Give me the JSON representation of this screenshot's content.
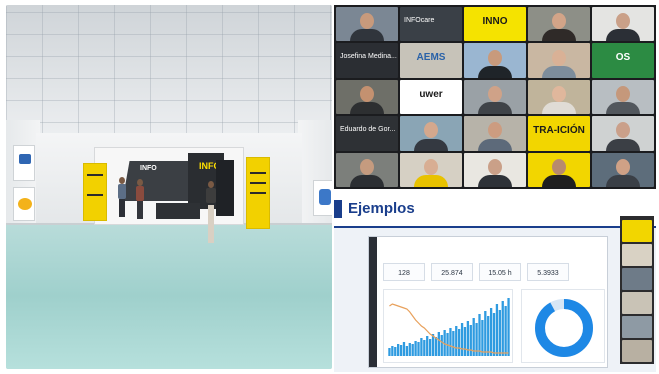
{
  "venue": {
    "stand_brand": "INFO",
    "stand_brand_secondary": "INFO",
    "caption": "",
    "footer_logos": [
      "",
      ""
    ]
  },
  "videoconference": {
    "tiles": [
      {
        "name": "",
        "bg": "#7b8794",
        "skin": "#c89a7c",
        "shirt": "#30353c"
      },
      {
        "name": "",
        "bg": "#3a4047",
        "label": "INFOcare"
      },
      {
        "name": "",
        "bg": "#f5e300",
        "logo": "INNO",
        "logo_color": "#1b1b1b"
      },
      {
        "name": "",
        "bg": "#8d8f87",
        "skin": "#d2a488",
        "shirt": "#2f2a28"
      },
      {
        "name": "",
        "bg": "#e4e4e2",
        "skin": "#caa088",
        "shirt": "#2b2f36"
      },
      {
        "name": "",
        "bg": "#2b2e33",
        "label": "Josefina Medina..."
      },
      {
        "name": "",
        "bg": "#c7c3b9",
        "logo": "AEMS",
        "logo_color": "#2a62a8"
      },
      {
        "name": "",
        "bg": "#9ab6d1",
        "skin": "#c89a7c",
        "shirt": "#1f2429"
      },
      {
        "name": "",
        "bg": "#c9b7a2",
        "skin": "#d9b196",
        "shirt": "#7d8d9c"
      },
      {
        "name": "",
        "bg": "#2c8b43",
        "logo": "OS",
        "logo_color": "#ffffff"
      },
      {
        "name": "",
        "bg": "#6e6f68",
        "skin": "#c49170",
        "shirt": "#2d2f31"
      },
      {
        "name": "",
        "bg": "#ffffff",
        "logo": "uwer",
        "logo_color": "#1b1b1b"
      },
      {
        "name": "",
        "bg": "#9aa1a6",
        "skin": "#cfa288",
        "shirt": "#3f4348"
      },
      {
        "name": "",
        "bg": "#c0b49b",
        "skin": "#e0b79c",
        "shirt": "#e0dcd5"
      },
      {
        "name": "",
        "bg": "#b8bec2",
        "skin": "#c5987b",
        "shirt": "#52575d"
      },
      {
        "name": "",
        "bg": "#2e3135",
        "label": "Eduardo de Gor..."
      },
      {
        "name": "",
        "bg": "#8aa5b5",
        "skin": "#d4a88d",
        "shirt": "#343941"
      },
      {
        "name": "",
        "bg": "#b7b3a9",
        "skin": "#cc9c80",
        "shirt": "#5d6a7a"
      },
      {
        "name": "",
        "bg": "#f2d600",
        "logo": "TRA-ICIÓN",
        "logo_color": "#1b1b1b"
      },
      {
        "name": "",
        "bg": "#cfd2d2",
        "skin": "#caa08a",
        "shirt": "#3b3f45"
      },
      {
        "name": "",
        "bg": "#7c7f7b",
        "skin": "#c59b7f",
        "shirt": "#2c2f33"
      },
      {
        "name": "",
        "bg": "#d6d0c4",
        "skin": "#d8ae93",
        "shirt": "#e8c200"
      },
      {
        "name": "",
        "bg": "#e9e7e1",
        "skin": "#caa088",
        "shirt": "#2e3238"
      },
      {
        "name": "",
        "bg": "#f2d600",
        "skin": "#b88a6e",
        "shirt": "#1f1f1f"
      },
      {
        "name": "",
        "bg": "#5d6d7b",
        "skin": "#cfa186",
        "shirt": "#3a3f46"
      }
    ]
  },
  "slide": {
    "title": "Ejemplos",
    "dashboard_title": "",
    "kpis": [
      {
        "label": "",
        "value": "128"
      },
      {
        "label": "",
        "value": "25.874"
      },
      {
        "label": "",
        "value": "15.05 h"
      },
      {
        "label": "",
        "value": "5.3933"
      }
    ],
    "bars": [
      8,
      10,
      9,
      12,
      11,
      14,
      10,
      13,
      12,
      15,
      14,
      18,
      16,
      20,
      17,
      22,
      19,
      24,
      21,
      26,
      23,
      28,
      25,
      30,
      27,
      33,
      29,
      35,
      31,
      38,
      33,
      42,
      36,
      45,
      40,
      48,
      43,
      52,
      46,
      55,
      50,
      58
    ],
    "line": [
      50,
      52,
      51,
      50,
      49,
      48,
      47,
      44,
      40,
      36,
      33,
      30,
      28,
      25,
      22,
      20,
      18,
      16,
      14,
      12,
      11,
      10,
      9,
      8,
      8,
      7,
      7,
      6,
      6,
      5,
      5,
      5,
      4,
      4,
      4,
      4,
      3,
      3,
      3,
      3,
      3,
      3
    ],
    "donut_share": 0.92,
    "colors": {
      "accent": "#1a3e8c",
      "bars": "#2f9be0",
      "line": "#e8a15c",
      "donut": "#1e88e5",
      "donut_rest": "#d7e6f5"
    },
    "thumbnail_colors": [
      "#f2d600",
      "#d9d2c4",
      "#6e7b88",
      "#c9c3b6",
      "#8e9aa4",
      "#b8b0a2"
    ]
  }
}
